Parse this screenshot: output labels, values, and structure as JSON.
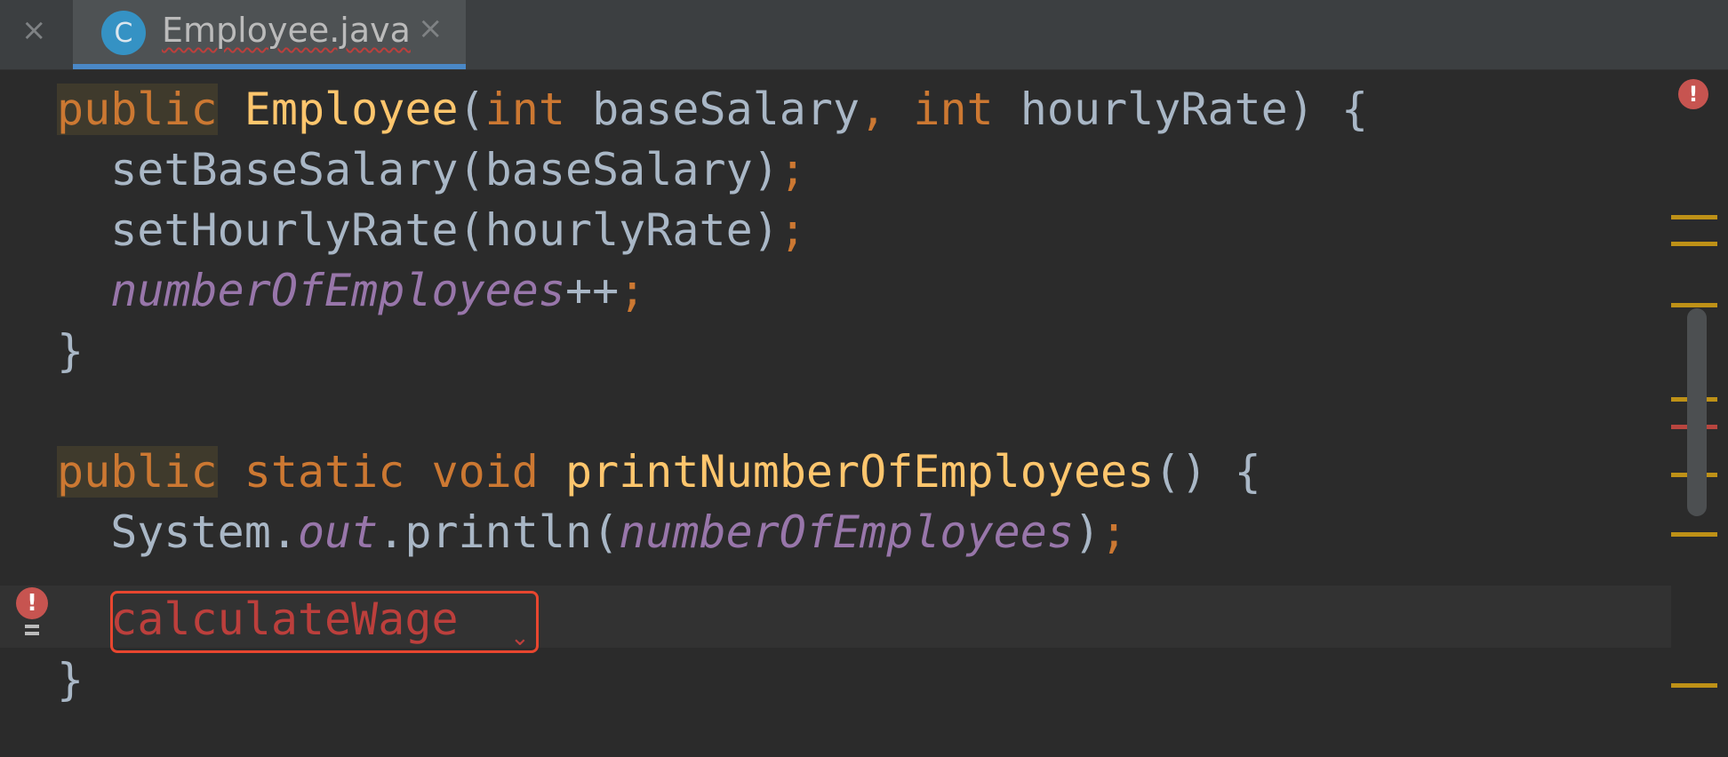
{
  "tabs": {
    "previous_tab": {
      "close_glyph": "×"
    },
    "active_tab": {
      "icon_letter": "C",
      "file_name": "Employee.java",
      "close_glyph": "×"
    }
  },
  "code": {
    "line1": {
      "kw": "public",
      "name": "Employee",
      "open": "(",
      "t1": "int",
      "p1": " baseSalary",
      "comma": ",",
      "t2": "int",
      "p2": " hourlyRate) {"
    },
    "line2": {
      "call": "  setBaseSalary(baseSalary)",
      "semi": ";"
    },
    "line3": {
      "call": "  setHourlyRate(hourlyRate)",
      "semi": ";"
    },
    "line4": {
      "indent": "  ",
      "field": "numberOfEmployees",
      "op": "++",
      "semi": ";"
    },
    "line5": {
      "text": "}"
    },
    "line6": {
      "kw1": "public",
      "kw2": "static",
      "kw3": "void",
      "name": "printNumberOfEmployees",
      "rest": "() {"
    },
    "line7": {
      "prefix": "  System.",
      "out": "out",
      "mid": ".println(",
      "field": "numberOfEmployees",
      "close": ")",
      "semi": ";"
    },
    "line8": {
      "indent": "  ",
      "error_text": "calculateWage"
    },
    "line9": {
      "text": "}"
    }
  },
  "colors": {
    "background": "#2b2b2b",
    "keyword": "#cc7832",
    "method_decl": "#ffc66d",
    "static_field": "#9876aa",
    "default_text": "#a9b7c6",
    "error": "#bc3f3c",
    "error_box": "#e8462f",
    "tab_underline": "#4a88c7"
  },
  "icons": {
    "gutter": "error-bulb-icon",
    "stripe": "error-indicator-icon",
    "file": "java-class-icon"
  }
}
